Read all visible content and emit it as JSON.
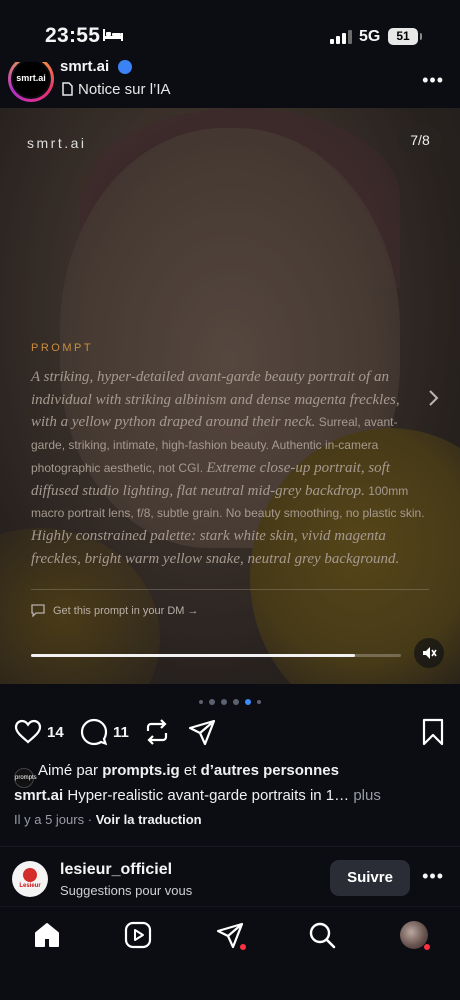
{
  "status_bar": {
    "time": "23:55",
    "network": "5G",
    "battery": "51"
  },
  "post_header": {
    "account": "smrt.ai",
    "avatar_text": "smrt.ai",
    "ai_notice": "Notice sur l’IA"
  },
  "media": {
    "brand": "smrt.ai",
    "slide_counter": "7/8",
    "prompt_label": "PROMPT",
    "prompt_parts": [
      "A striking, hyper-detailed avant-garde beauty portrait of an individual with striking albinism and dense magenta freckles, with a yellow python draped around their neck.",
      " Surreal, avant-garde, striking, intimate, high-fashion beauty. Authentic in-camera photographic aesthetic, not CGI. ",
      "Extreme close-up portrait, soft diffused studio lighting, flat neutral mid-grey backdrop.",
      " 100mm macro portrait lens, f/8, subtle grain. No beauty smoothing, no plastic skin. ",
      "Highly constrained palette: stark white skin, vivid magenta freckles, bright warm yellow snake, neutral grey background."
    ],
    "dm_link": "Get this prompt in your DM →",
    "progress": 0.875
  },
  "carousel": {
    "dot_count": 6,
    "active_index": 4
  },
  "actions": {
    "likes_count": "14",
    "comments_count": "11"
  },
  "likes_line": {
    "prefix": "Aimé par",
    "user": "prompts.ig",
    "connector": "et",
    "others": "d’autres personnes",
    "avatar_text": "prompts"
  },
  "caption": {
    "user": "smrt.ai",
    "text": "Hyper-realistic avant-garde portraits in 1…",
    "more": "plus"
  },
  "meta": {
    "time_ago": "Il y a 5 jours",
    "separator": "·",
    "translate": "Voir la traduction"
  },
  "suggestion": {
    "name": "lesieur_officiel",
    "subtitle": "Suggestions pour vous",
    "follow": "Suivre",
    "avatar_text": "Lesieur"
  },
  "colors": {
    "background": "#0b0d13",
    "accent_prompt": "#c98d3e",
    "active_dot": "#3b8cf7",
    "notification_dot": "#ff3040"
  },
  "icons": [
    "bed-icon",
    "signal-icon",
    "battery-icon",
    "verified-icon",
    "ai-notice-icon",
    "more-icon",
    "chevron-right-icon",
    "dm-icon",
    "mute-icon",
    "heart-icon",
    "comment-icon",
    "repost-icon",
    "share-icon",
    "bookmark-icon",
    "home-icon",
    "reels-icon",
    "messages-icon",
    "search-icon",
    "profile-icon"
  ]
}
